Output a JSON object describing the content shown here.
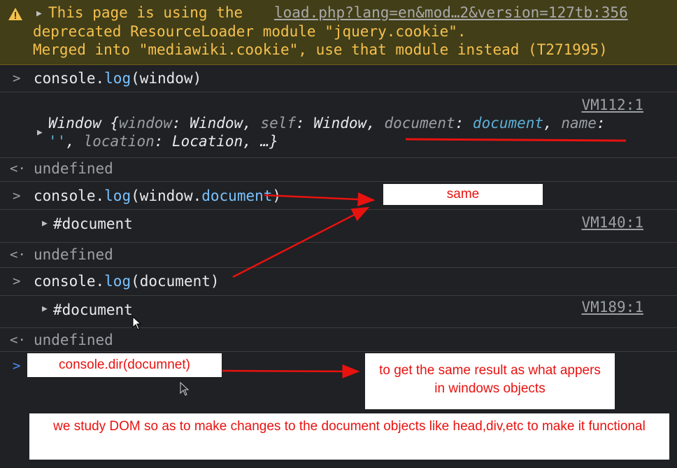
{
  "warning": {
    "icon": "warning-icon",
    "line1": "This page is using the",
    "source": "load.php?lang=en&mod…2&version=127tb:356",
    "line2": "deprecated ResourceLoader module \"jquery.cookie\".",
    "line3": "Merged into \"mediawiki.cookie\", use that module instead (T271995)"
  },
  "entries": [
    {
      "prefix": "console.",
      "fn": "log",
      "args": "(window)"
    },
    {
      "prefix": "console.",
      "fn": "log",
      "args": "(window.",
      "args_hl": "document",
      "args_end": ")"
    },
    {
      "prefix": "console.",
      "fn": "log",
      "args": "(document)"
    }
  ],
  "outputs": {
    "window_source": "VM112:1",
    "window_line1_a": "Window {",
    "window_k1": "window",
    "window_v1": ": Window, ",
    "window_k2": "self",
    "window_v2": ": Window, ",
    "window_k3": "document",
    "window_v3": ": ",
    "window_v3b": "document",
    "window_sep": ", ",
    "window_k4": "name",
    "window_colon": ":",
    "window_line2_str": "''",
    "window_line2_a": ", ",
    "window_k5": "location",
    "window_line2_b": ": Location, …}",
    "doc1": "#document",
    "doc1_source": "VM140:1",
    "doc2": "#document",
    "doc2_source": "VM189:1",
    "undefined": "undefined"
  },
  "annotations": {
    "same": "same",
    "input_note": "console.dir(documnet)",
    "result_note": "to get the same result as what appers in windows objects",
    "bottom_note": "we study DOM so as to make changes to the document objects like head,div,etc to make it functional"
  },
  "colors": {
    "background": "#202124",
    "warning_bg": "#413e18",
    "warning_text": "#f5c04e",
    "annotation_red": "#e8120f"
  }
}
